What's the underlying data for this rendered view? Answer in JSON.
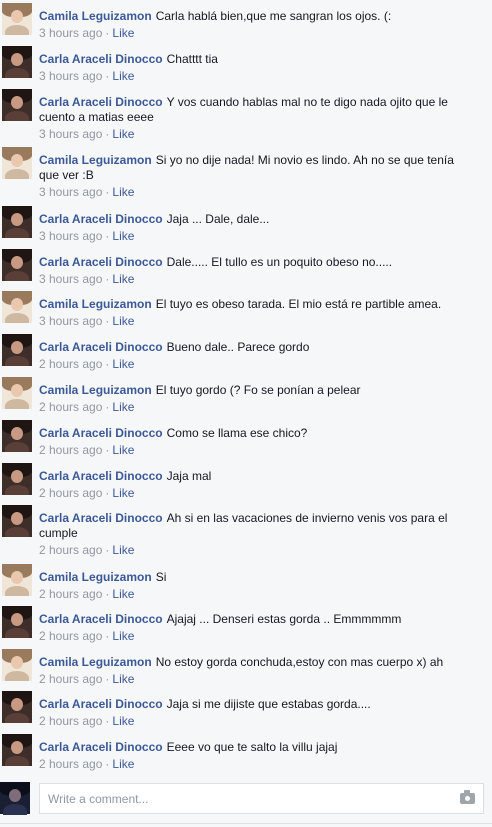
{
  "comments": [
    {
      "author": "Camila Leguizamon",
      "avatar": "camila",
      "text": "Carla hablá bien,que me sangran los ojos. (:",
      "time": "3 hours ago",
      "like": "Like"
    },
    {
      "author": "Carla Araceli Dinocco",
      "avatar": "carla",
      "text": "Chatttt tia",
      "time": "3 hours ago",
      "like": "Like"
    },
    {
      "author": "Carla Araceli Dinocco",
      "avatar": "carla",
      "text": "Y vos cuando hablas mal no te digo nada ojito que le cuento a matias eeee",
      "time": "3 hours ago",
      "like": "Like"
    },
    {
      "author": "Camila Leguizamon",
      "avatar": "camila",
      "text": "Si yo no dije nada! Mi novio es lindo. Ah no se que tenía que ver :B",
      "time": "3 hours ago",
      "like": "Like"
    },
    {
      "author": "Carla Araceli Dinocco",
      "avatar": "carla",
      "text": "Jaja ... Dale, dale...",
      "time": "3 hours ago",
      "like": "Like"
    },
    {
      "author": "Carla Araceli Dinocco",
      "avatar": "carla",
      "text": "Dale..... El tullo es un poquito obeso no.....",
      "time": "3 hours ago",
      "like": "Like"
    },
    {
      "author": "Camila Leguizamon",
      "avatar": "camila",
      "text": "El tuyo es obeso tarada. El mio está re partible amea.",
      "time": "3 hours ago",
      "like": "Like"
    },
    {
      "author": "Carla Araceli Dinocco",
      "avatar": "carla",
      "text": "Bueno dale.. Parece gordo",
      "time": "2 hours ago",
      "like": "Like"
    },
    {
      "author": "Camila Leguizamon",
      "avatar": "camila",
      "text": "El tuyo gordo (? Fo se ponían a pelear",
      "time": "2 hours ago",
      "like": "Like"
    },
    {
      "author": "Carla Araceli Dinocco",
      "avatar": "carla",
      "text": "Como se llama ese chico?",
      "time": "2 hours ago",
      "like": "Like"
    },
    {
      "author": "Carla Araceli Dinocco",
      "avatar": "carla",
      "text": "Jaja mal",
      "time": "2 hours ago",
      "like": "Like"
    },
    {
      "author": "Carla Araceli Dinocco",
      "avatar": "carla",
      "text": "Ah si en las vacaciones de invierno venis vos para el cumple",
      "time": "2 hours ago",
      "like": "Like"
    },
    {
      "author": "Camila Leguizamon",
      "avatar": "camila",
      "text": "Si",
      "time": "2 hours ago",
      "like": "Like"
    },
    {
      "author": "Carla Araceli Dinocco",
      "avatar": "carla",
      "text": "Ajajaj ... Denseri estas gorda .. Emmmmmm",
      "time": "2 hours ago",
      "like": "Like"
    },
    {
      "author": "Camila Leguizamon",
      "avatar": "camila",
      "text": "No estoy gorda conchuda,estoy con mas cuerpo x) ah",
      "time": "2 hours ago",
      "like": "Like"
    },
    {
      "author": "Carla Araceli Dinocco",
      "avatar": "carla",
      "text": "Jaja si me dijiste que estabas gorda....",
      "time": "2 hours ago",
      "like": "Like"
    },
    {
      "author": "Carla Araceli Dinocco",
      "avatar": "carla",
      "text": "Eeee vo que te salto la villu jajaj",
      "time": "2 hours ago",
      "like": "Like"
    }
  ],
  "composer": {
    "placeholder": "Write a comment...",
    "icon": "camera-icon"
  }
}
